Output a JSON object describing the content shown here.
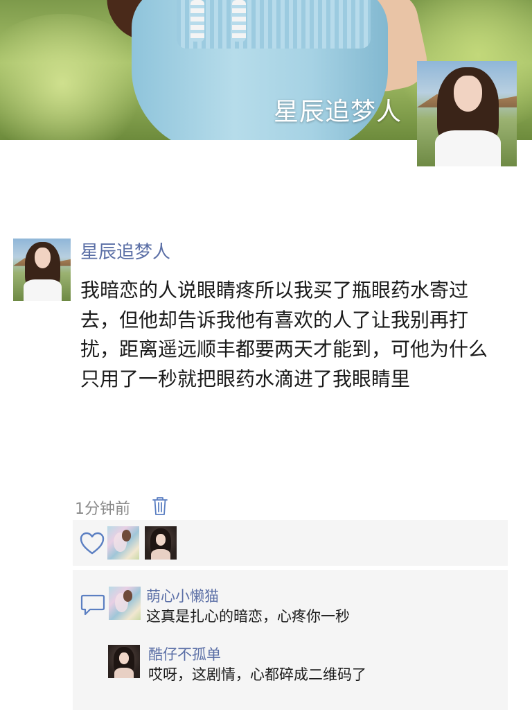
{
  "profile": {
    "cover_name": "星辰追梦人"
  },
  "post": {
    "author": "星辰追梦人",
    "text": "我暗恋的人说眼睛疼所以我买了瓶眼药水寄过去，但他却告诉我他有喜欢的人了让我别再打扰，距离遥远顺丰都要两天才能到，可他为什么只用了一秒就把眼药水滴进了我眼睛里",
    "time": "1分钟前"
  },
  "likes": {
    "icon": "heart-icon"
  },
  "comments": [
    {
      "name": "萌心小懒猫",
      "text": "这真是扎心的暗恋，心疼你一秒"
    },
    {
      "name": "酷仔不孤单",
      "text": "哎呀，这剧情，心都碎成二维码了"
    }
  ],
  "icons": {
    "delete": "trash-icon",
    "comment": "comment-icon"
  },
  "colors": {
    "link": "#5b6fa6",
    "panel": "#f5f5f5",
    "icon": "#5b7fc2"
  }
}
